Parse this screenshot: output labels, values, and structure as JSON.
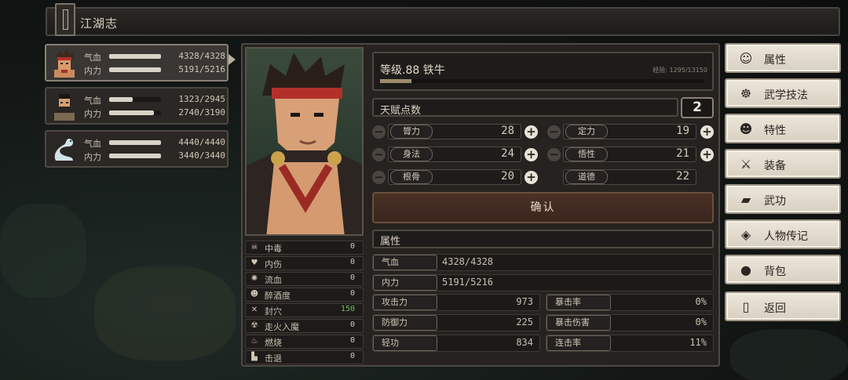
{
  "window": {
    "title": "江湖志"
  },
  "party": [
    {
      "hp_label": "气血",
      "hp": "4328/4328",
      "hp_fill": 1.0,
      "mp_label": "内力",
      "mp": "5191/5216",
      "mp_fill": 0.995
    },
    {
      "hp_label": "气血",
      "hp": "1323/2945",
      "hp_fill": 0.449,
      "mp_label": "内力",
      "mp": "2740/3190",
      "mp_fill": 0.859
    },
    {
      "hp_label": "气血",
      "hp": "4440/4440",
      "hp_fill": 1.0,
      "mp_label": "内力",
      "mp": "3440/3440",
      "mp_fill": 1.0
    }
  ],
  "character": {
    "level_text": "等级.88  铁牛",
    "exp_text": "经验: 1295/13150",
    "exp_fill": 0.098
  },
  "talent": {
    "label": "天赋点数",
    "value": "2"
  },
  "stats": [
    {
      "name": "膂力",
      "value": "28"
    },
    {
      "name": "定力",
      "value": "19"
    },
    {
      "name": "身法",
      "value": "24"
    },
    {
      "name": "悟性",
      "value": "21"
    },
    {
      "name": "根骨",
      "value": "20"
    },
    {
      "name": "道德",
      "value": "22"
    }
  ],
  "confirm_label": "确认",
  "attributes": {
    "header": "属性",
    "hp_label": "气血",
    "hp_value": "4328/4328",
    "mp_label": "内力",
    "mp_value": "5191/5216",
    "cells": [
      {
        "label": "攻击力",
        "value": "973"
      },
      {
        "label": "暴击率",
        "value": "0%"
      },
      {
        "label": "防御力",
        "value": "225"
      },
      {
        "label": "暴击伤害",
        "value": "0%"
      },
      {
        "label": "轻功",
        "value": "834"
      },
      {
        "label": "连击率",
        "value": "11%"
      }
    ]
  },
  "status_effects": [
    {
      "icon": "skull-icon",
      "name": "中毒",
      "value": "0"
    },
    {
      "icon": "broken-heart-icon",
      "name": "内伤",
      "value": "0"
    },
    {
      "icon": "blood-drop-icon",
      "name": "流血",
      "value": "0"
    },
    {
      "icon": "drunk-face-icon",
      "name": "醉酒度",
      "value": "0"
    },
    {
      "icon": "acupoint-icon",
      "name": "封穴",
      "value": "150"
    },
    {
      "icon": "demon-icon",
      "name": "走火入魔",
      "value": "0"
    },
    {
      "icon": "flame-icon",
      "name": "燃烧",
      "value": "0"
    },
    {
      "icon": "retreat-icon",
      "name": "击退",
      "value": "0"
    }
  ],
  "menu": [
    {
      "icon": "character-icon",
      "label": "属性"
    },
    {
      "icon": "martial-skills-icon",
      "label": "武学技法"
    },
    {
      "icon": "traits-icon",
      "label": "特性"
    },
    {
      "icon": "sword-icon",
      "label": "装备"
    },
    {
      "icon": "martial-book-icon",
      "label": "武功"
    },
    {
      "icon": "scroll-icon",
      "label": "人物传记"
    },
    {
      "icon": "bag-icon",
      "label": "背包"
    },
    {
      "icon": "door-icon",
      "label": "返回"
    }
  ],
  "colors": {
    "accent_green": "#6bbf4e",
    "confirm_red": "#4a3126",
    "menu_bg": "#ece6da"
  }
}
